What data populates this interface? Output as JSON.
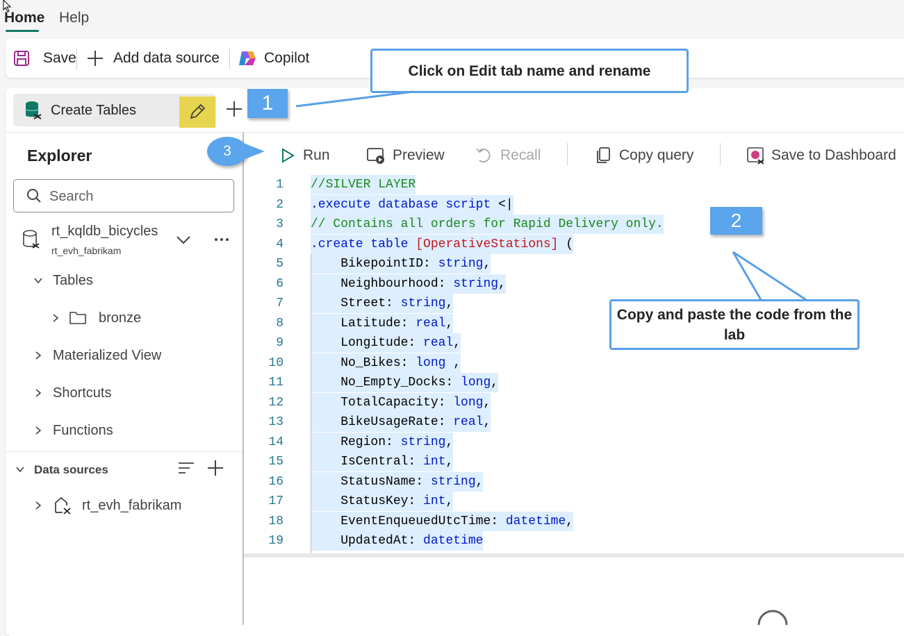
{
  "nav": {
    "home": "Home",
    "help": "Help"
  },
  "toolbar": {
    "save": "Save",
    "add_data_source": "Add data source",
    "copilot": "Copilot"
  },
  "query_tab": {
    "label": "Create Tables"
  },
  "explorer": {
    "title": "Explorer",
    "search_placeholder": "Search",
    "database": {
      "name": "rt_kqldb_bicycles",
      "subtitle": "rt_evh_fabrikam"
    },
    "tables": "Tables",
    "bronze": "bronze",
    "materialized_view": "Materialized View",
    "shortcuts": "Shortcuts",
    "functions": "Functions",
    "data_sources": "Data sources",
    "data_source_item": "rt_evh_fabrikam"
  },
  "editor_toolbar": {
    "run": "Run",
    "preview": "Preview",
    "recall": "Recall",
    "copy_query": "Copy query",
    "save_to_dashboard": "Save to Dashboard"
  },
  "code": {
    "lines": [
      {
        "n": "1",
        "parts": [
          {
            "t": "//SILVER LAYER",
            "c": "green"
          }
        ]
      },
      {
        "n": "2",
        "parts": [
          {
            "t": ".execute database script ",
            "c": "blue"
          },
          {
            "t": "<|",
            "c": "plain"
          }
        ]
      },
      {
        "n": "3",
        "parts": [
          {
            "t": "// Contains all orders for Rapid Delivery only.",
            "c": "green"
          }
        ]
      },
      {
        "n": "4",
        "parts": [
          {
            "t": ".create table ",
            "c": "blue"
          },
          {
            "t": "[OperativeStations]",
            "c": "red"
          },
          {
            "t": " (",
            "c": "plain"
          }
        ]
      },
      {
        "n": "5",
        "parts": [
          {
            "t": "    BikepointID: ",
            "c": "plain"
          },
          {
            "t": "string",
            "c": "blue"
          },
          {
            "t": ",",
            "c": "plain"
          }
        ]
      },
      {
        "n": "6",
        "parts": [
          {
            "t": "    Neighbourhood: ",
            "c": "plain"
          },
          {
            "t": "string",
            "c": "blue"
          },
          {
            "t": ",",
            "c": "plain"
          }
        ]
      },
      {
        "n": "7",
        "parts": [
          {
            "t": "    Street: ",
            "c": "plain"
          },
          {
            "t": "string",
            "c": "blue"
          },
          {
            "t": ",",
            "c": "plain"
          }
        ]
      },
      {
        "n": "8",
        "parts": [
          {
            "t": "    Latitude: ",
            "c": "plain"
          },
          {
            "t": "real",
            "c": "blue"
          },
          {
            "t": ",",
            "c": "plain"
          }
        ]
      },
      {
        "n": "9",
        "parts": [
          {
            "t": "    Longitude: ",
            "c": "plain"
          },
          {
            "t": "real",
            "c": "blue"
          },
          {
            "t": ",",
            "c": "plain"
          }
        ]
      },
      {
        "n": "10",
        "parts": [
          {
            "t": "    No_Bikes: ",
            "c": "plain"
          },
          {
            "t": "long",
            "c": "blue"
          },
          {
            "t": " ,",
            "c": "plain"
          }
        ]
      },
      {
        "n": "11",
        "parts": [
          {
            "t": "    No_Empty_Docks: ",
            "c": "plain"
          },
          {
            "t": "long",
            "c": "blue"
          },
          {
            "t": ",",
            "c": "plain"
          }
        ]
      },
      {
        "n": "12",
        "parts": [
          {
            "t": "    TotalCapacity: ",
            "c": "plain"
          },
          {
            "t": "long",
            "c": "blue"
          },
          {
            "t": ",",
            "c": "plain"
          }
        ]
      },
      {
        "n": "13",
        "parts": [
          {
            "t": "    BikeUsageRate: ",
            "c": "plain"
          },
          {
            "t": "real",
            "c": "blue"
          },
          {
            "t": ",",
            "c": "plain"
          }
        ]
      },
      {
        "n": "14",
        "parts": [
          {
            "t": "    Region: ",
            "c": "plain"
          },
          {
            "t": "string",
            "c": "blue"
          },
          {
            "t": ",",
            "c": "plain"
          }
        ]
      },
      {
        "n": "15",
        "parts": [
          {
            "t": "    IsCentral: ",
            "c": "plain"
          },
          {
            "t": "int",
            "c": "blue"
          },
          {
            "t": ",",
            "c": "plain"
          }
        ]
      },
      {
        "n": "16",
        "parts": [
          {
            "t": "    StatusName: ",
            "c": "plain"
          },
          {
            "t": "string",
            "c": "blue"
          },
          {
            "t": ",",
            "c": "plain"
          }
        ]
      },
      {
        "n": "17",
        "parts": [
          {
            "t": "    StatusKey: ",
            "c": "plain"
          },
          {
            "t": "int",
            "c": "blue"
          },
          {
            "t": ",",
            "c": "plain"
          }
        ]
      },
      {
        "n": "18",
        "parts": [
          {
            "t": "    EventEnqueuedUtcTime: ",
            "c": "plain"
          },
          {
            "t": "datetime",
            "c": "blue"
          },
          {
            "t": ",",
            "c": "plain"
          }
        ]
      },
      {
        "n": "19",
        "parts": [
          {
            "t": "    UpdatedAt: ",
            "c": "plain"
          },
          {
            "t": "datetime",
            "c": "blue"
          }
        ]
      }
    ]
  },
  "annotations": {
    "callout_rename": "Click on Edit tab name and rename",
    "callout_copy": "Copy and paste the code from the lab",
    "badge1": "1",
    "badge2": "2",
    "badge3": "3"
  },
  "colors": {
    "accent": "#117865",
    "callout_border": "#5aa0e6",
    "badge": "#5aa5ec",
    "highlight": "#e8d54f"
  }
}
